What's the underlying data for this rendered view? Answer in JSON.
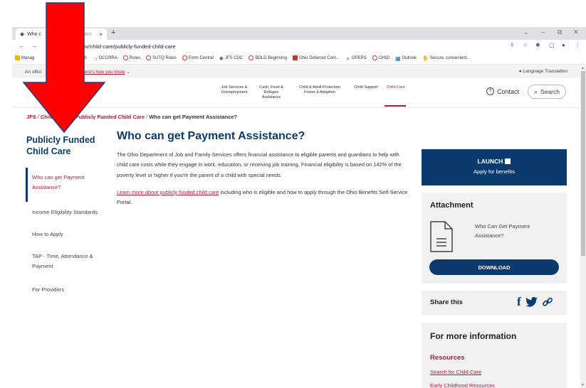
{
  "browser": {
    "tab_title": "Who can Get Payment Assistance",
    "tab_title_visible_left": "Who c",
    "tab_title_visible_right": "tanc",
    "tab_close": "×",
    "new_tab": "+",
    "url_visible": "ohio.gov/child-care/publicly-funded-child-care",
    "bookmarks": [
      {
        "label": "Manag",
        "icon": "folder-icon",
        "color": "#f2b705"
      },
      {
        "label": "DCLQS",
        "icon": "folder-icon",
        "color": "#f2b705"
      },
      {
        "label": "OCCRRA",
        "icon": "occrra-icon",
        "color": "#8bc34a"
      },
      {
        "label": "Rules",
        "icon": "circle-icon",
        "color": "#d33"
      },
      {
        "label": "SUTQ Rules",
        "icon": "circle-icon",
        "color": "#d33"
      },
      {
        "label": "Form Central",
        "icon": "circle-icon",
        "color": "#d33"
      },
      {
        "label": "JFS CDC",
        "icon": "globe-icon",
        "color": "#555"
      },
      {
        "label": "BOLD Beginning",
        "icon": "circle-icon",
        "color": "#d33"
      },
      {
        "label": "Ohio Deferred Com...",
        "icon": "square-icon",
        "color": "#c0392b"
      },
      {
        "label": "OPERS",
        "icon": "triangle-icon",
        "color": "#8bc34a"
      },
      {
        "label": "OHID",
        "icon": "circle-icon",
        "color": "#d33"
      },
      {
        "label": "Outlook",
        "icon": "grid-icon",
        "color": "#0078d4"
      },
      {
        "label": "Secure, convenient...",
        "icon": "hand-icon",
        "color": "#e67e22"
      }
    ]
  },
  "ohio_bar": {
    "official_visible": "An offici",
    "how_you_know": "Here's how you know",
    "language": "Language Translation"
  },
  "header": {
    "nav": [
      {
        "label": "Job Services & Unemployment"
      },
      {
        "label": "Cash, Food & Refugee Assistance"
      },
      {
        "label": "Child & Adult Protection Foster & Adoption"
      },
      {
        "label": "Child Support"
      },
      {
        "label": "Child Care"
      }
    ],
    "contact": "Contact",
    "search": "Search"
  },
  "breadcrumb": {
    "jfs": "JFS",
    "child": "Child",
    "publicly_funded": "Publicly Funded Child Care",
    "current": "Who can get Payment Assistance?"
  },
  "sidebar": {
    "title": "Publicly Funded Child Care",
    "items": [
      {
        "label": "Who can get Payment Assistance?"
      },
      {
        "label": "Income Eligibility Standards"
      },
      {
        "label": "How to Apply"
      },
      {
        "label": "TAP - Time, Attendance & Payment"
      },
      {
        "label": "For Providers"
      }
    ]
  },
  "main": {
    "title": "Who can get Payment Assistance?",
    "paragraph1": "The Ohio Department of Job and Family Services offers financial assistance to eligible parents and guardians to help with child care costs while they engage in work, education, or receiving job training. Financial eligibility is based on 142% of the poverty level or higher if you're the parent of a child with special needs.",
    "paragraph2_link": "Learn more about publicly funded child care",
    "paragraph2_rest": " including who is eligible and how to apply through the Ohio Benefits Self-Service Portal."
  },
  "rail": {
    "launch": "LAUNCH",
    "apply": "Apply for benefits",
    "attachment_title": "Attachment",
    "attachment_name": "Who Can Get Payment Assistance?",
    "download": "DOWNLOAD",
    "share_title": "Share this",
    "more_title": "For more information",
    "resources_title": "Resources",
    "resources": [
      {
        "label": "Search for Child Care"
      },
      {
        "label": "Early Childhood Resources"
      }
    ]
  },
  "colors": {
    "brand_blue": "#0b3b6e",
    "brand_red": "#b5192e",
    "arrow_red": "#ff0000"
  }
}
